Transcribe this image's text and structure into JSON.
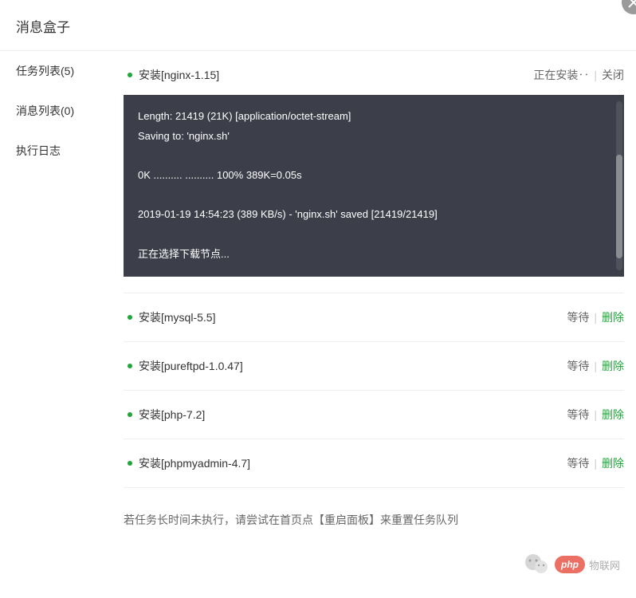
{
  "header": {
    "title": "消息盒子"
  },
  "sidebar": {
    "items": [
      {
        "label": "任务列表(5)",
        "active": true
      },
      {
        "label": "消息列表(0)",
        "active": false
      },
      {
        "label": "执行日志",
        "active": false
      }
    ]
  },
  "tasks": [
    {
      "title": "安装[nginx-1.15]",
      "status": "正在安装‥",
      "action": "关闭",
      "actionType": "close",
      "hasTerminal": true
    },
    {
      "title": "安装[mysql-5.5]",
      "status": "等待",
      "action": "删除",
      "actionType": "delete",
      "hasTerminal": false
    },
    {
      "title": "安装[pureftpd-1.0.47]",
      "status": "等待",
      "action": "删除",
      "actionType": "delete",
      "hasTerminal": false
    },
    {
      "title": "安装[php-7.2]",
      "status": "等待",
      "action": "删除",
      "actionType": "delete",
      "hasTerminal": false
    },
    {
      "title": "安装[phpmyadmin-4.7]",
      "status": "等待",
      "action": "删除",
      "actionType": "delete",
      "hasTerminal": false
    }
  ],
  "terminal": {
    "lines": [
      "Length: 21419 (21K) [application/octet-stream]",
      "Saving to: 'nginx.sh'",
      "",
      "0K .......... .......... 100% 389K=0.05s",
      "",
      "2019-01-19 14:54:23 (389 KB/s) - 'nginx.sh' saved [21419/21419]",
      "",
      "正在选择下载节点..."
    ]
  },
  "footer": {
    "hint": "若任务长时间未执行，请尝试在首页点【重启面板】来重置任务队列"
  },
  "watermark": {
    "brand": "php",
    "text": "物联网"
  }
}
